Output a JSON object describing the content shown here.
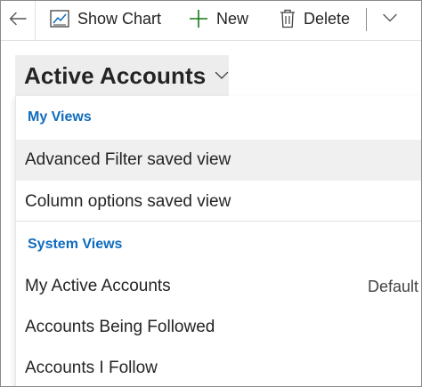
{
  "toolbar": {
    "show_chart_label": "Show Chart",
    "new_label": "New",
    "delete_label": "Delete"
  },
  "icons": {
    "back": "arrow-left-icon",
    "show_chart": "chart-icon",
    "new": "plus-icon",
    "delete": "trash-icon",
    "more": "chevron-down-icon",
    "view_selector": "chevron-down-icon"
  },
  "colors": {
    "accent": "#0f6cbd",
    "new_plus": "#107c10",
    "selector_bg": "#ededed",
    "hover_bg": "#f0f0f0"
  },
  "view_selector": {
    "title": "Active Accounts"
  },
  "dropdown": {
    "my_views_header": "My Views",
    "my_views": [
      {
        "label": "Advanced Filter saved view"
      },
      {
        "label": "Column options saved view"
      }
    ],
    "system_views_header": "System Views",
    "system_views": [
      {
        "label": "My Active Accounts",
        "badge": "Default"
      },
      {
        "label": "Accounts Being Followed"
      },
      {
        "label": "Accounts I Follow"
      }
    ]
  }
}
